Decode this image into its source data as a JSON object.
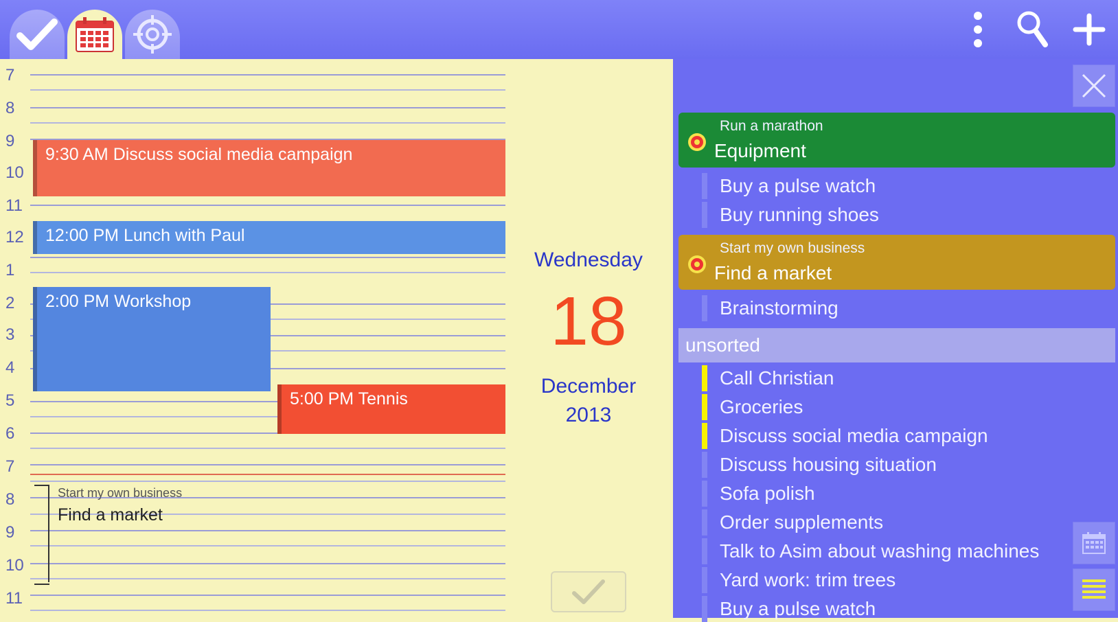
{
  "toolbar": {
    "tabs": [
      {
        "icon": "checkmark-icon",
        "active": false
      },
      {
        "icon": "calendar-icon",
        "active": true
      },
      {
        "icon": "target-icon",
        "active": false
      }
    ],
    "actions": [
      {
        "icon": "overflow-menu-icon"
      },
      {
        "icon": "search-icon"
      },
      {
        "icon": "add-icon"
      }
    ]
  },
  "schedule": {
    "hours": [
      "7",
      "8",
      "9",
      "10",
      "11",
      "12",
      "1",
      "2",
      "3",
      "4",
      "5",
      "6",
      "7",
      "8",
      "9",
      "10",
      "11"
    ],
    "events": [
      {
        "time": "9:30 AM",
        "title": "Discuss social media campaign",
        "color": "#f26b50"
      },
      {
        "time": "12:00 PM",
        "title": "Lunch with Paul",
        "color": "#5b92e4"
      },
      {
        "time": "2:00 PM",
        "title": "Workshop",
        "color": "#5486df"
      },
      {
        "time": "5:00 PM",
        "title": "Tennis",
        "color": "#f24f33"
      }
    ],
    "goal_block": {
      "parent": "Start my own business",
      "name": "Find a market"
    }
  },
  "date": {
    "weekday": "Wednesday",
    "day": "18",
    "month": "December",
    "year": "2013"
  },
  "tasks": {
    "goals": [
      {
        "parent": "Run a marathon",
        "title": "Equipment",
        "color": "#1b8a36",
        "items": [
          "Buy a pulse watch",
          "Buy running shoes"
        ]
      },
      {
        "parent": "Start my own business",
        "title": "Find a market",
        "color": "#c3961f",
        "items": [
          "Brainstorming"
        ]
      }
    ],
    "unsorted_label": "unsorted",
    "unsorted": [
      {
        "title": "Call Christian",
        "flagged": true
      },
      {
        "title": "Groceries",
        "flagged": true
      },
      {
        "title": "Discuss social media campaign",
        "flagged": true
      },
      {
        "title": "Discuss housing situation",
        "flagged": false
      },
      {
        "title": "Sofa polish",
        "flagged": false
      },
      {
        "title": "Order supplements",
        "flagged": false
      },
      {
        "title": "Talk to Asim about washing machines",
        "flagged": false
      },
      {
        "title": "Yard work: trim trees",
        "flagged": false
      },
      {
        "title": "Buy a pulse watch",
        "flagged": false
      }
    ]
  }
}
